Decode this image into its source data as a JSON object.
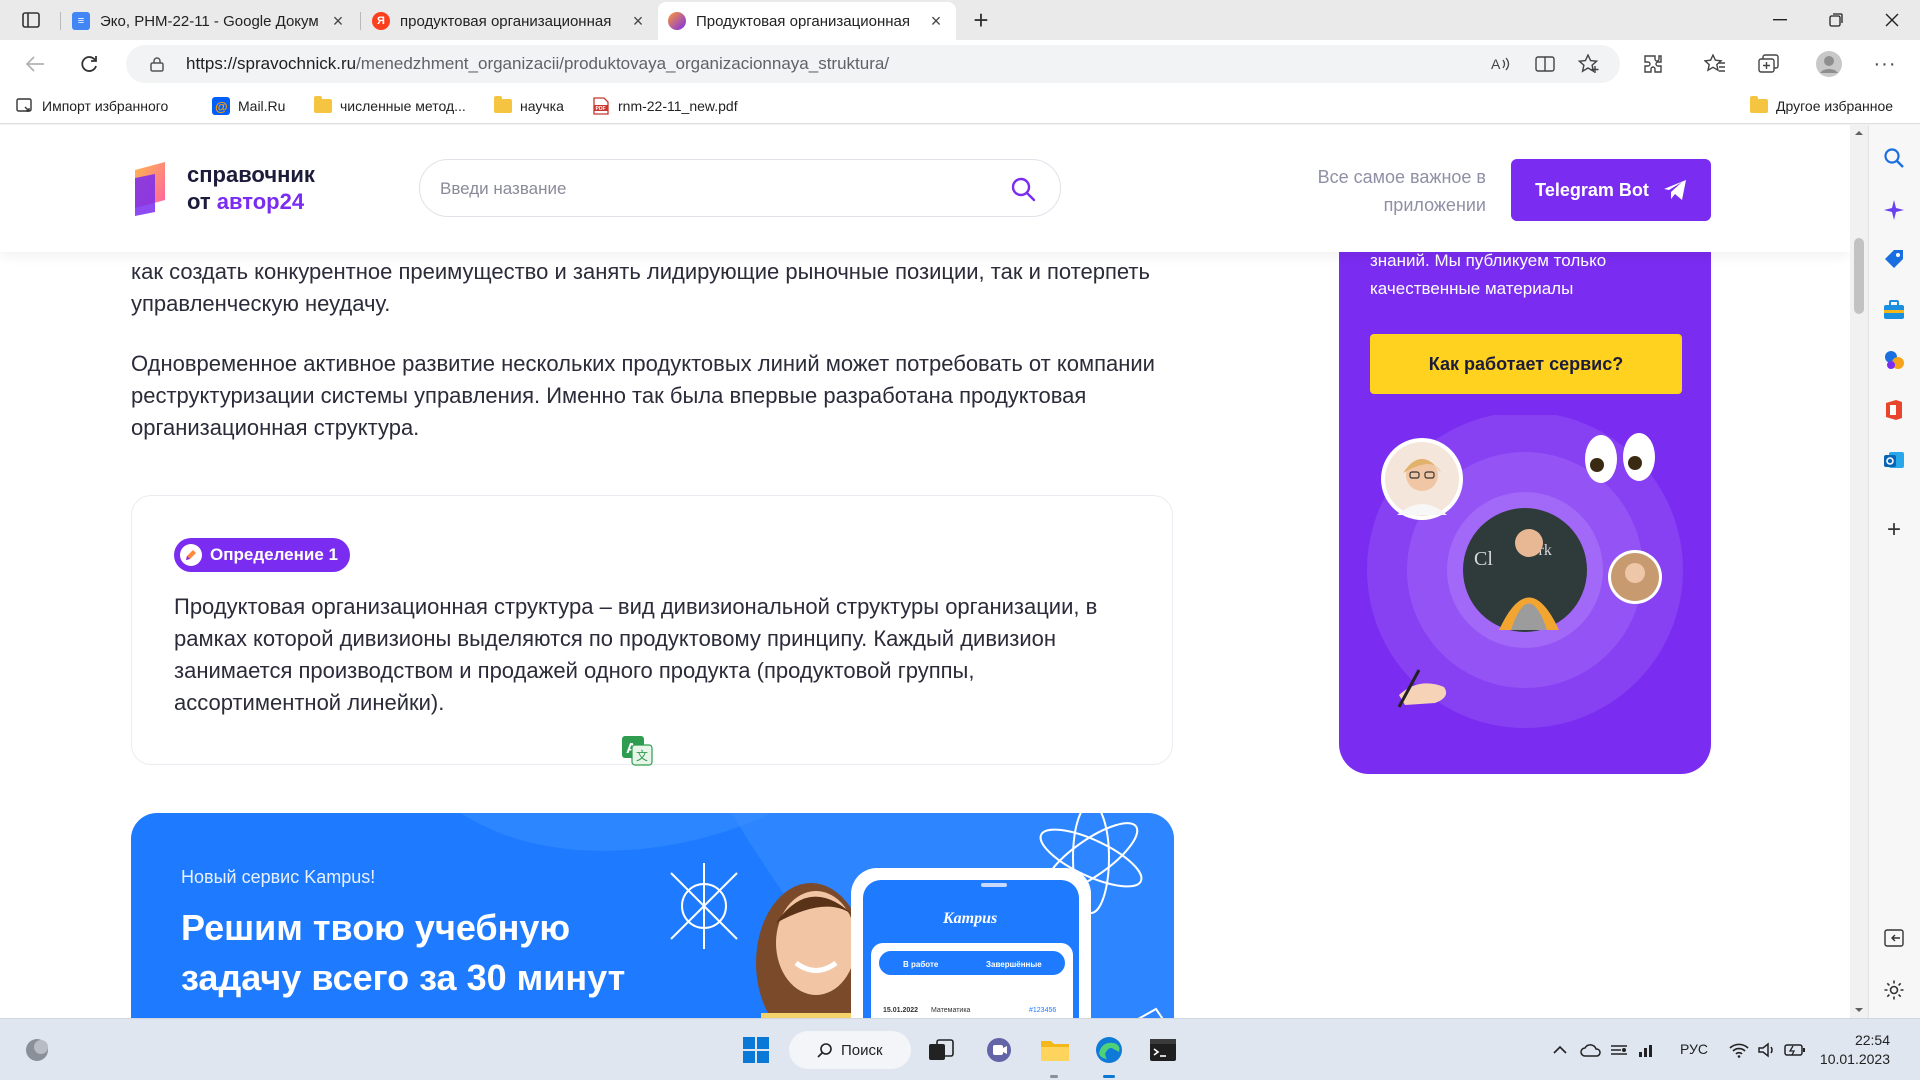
{
  "browser": {
    "tabs": [
      {
        "label": "Эко, РНМ-22-11 - Google Докум",
        "favicon": "google-docs-icon"
      },
      {
        "label": "продуктовая организационная",
        "favicon": "yandex-icon"
      },
      {
        "label": "Продуктовая организационная",
        "favicon": "kampus-icon",
        "active": true
      }
    ],
    "url_host": "https://spravochnick.ru",
    "url_path": "/menedzhment_organizacii/produktovaya_organizacionnaya_struktura/",
    "bookmarks": [
      {
        "label": "Импорт избранного",
        "icon": "import-icon"
      },
      {
        "label": "Mail.Ru",
        "icon": "mailru-icon"
      },
      {
        "label": "численные метод...",
        "icon": "folder-icon"
      },
      {
        "label": "научка",
        "icon": "folder-icon"
      },
      {
        "label": "rnm-22-11_new.pdf",
        "icon": "pdf-icon"
      }
    ],
    "other_bookmarks": "Другое избранное"
  },
  "site": {
    "logo_line1": "справочник",
    "logo_line2_prefix": "от ",
    "logo_line2_accent": "автор24",
    "search_placeholder": "Введи название",
    "app_note": "Все самое важное в приложении",
    "telegram_button": "Telegram Bot",
    "accent_color": "#7a2cf0"
  },
  "article": {
    "para1": "как создать конкурентное преимущество и занять лидирующие рыночные позиции, так и потерпеть управленческую неудачу.",
    "para2": "Одновременное активное развитие нескольких продуктовых линий может потребовать от компании реструктуризации системы управления. Именно так была впервые разработана продуктовая организационная структура.",
    "definition_badge": "Определение 1",
    "definition_text": "Продуктовая организационная структура – вид дивизиональной структуры организации, в рамках которой дивизионы выделяются по продуктовому принципу. Каждый дивизион занимается производством и продажей одного продукта (продуктовой группы, ассортиментной линейки)."
  },
  "promo": {
    "label": "Новый сервис Kampus!",
    "title": "Решим твою учебную задачу всего за 30 минут",
    "phone_brand": "Kampus",
    "phone_tab1": "В работе",
    "phone_tab2": "Завершённые",
    "phone_row_date": "15.01.2022",
    "phone_row_subject": "Математика",
    "phone_row_id": "#123456"
  },
  "sidebar": {
    "text": "знаний. Мы публикуем только качественные материалы",
    "button": "Как работает сервис?"
  },
  "taskbar": {
    "search_label": "Поиск",
    "language": "РУС",
    "time": "22:54",
    "date": "10.01.2023"
  }
}
